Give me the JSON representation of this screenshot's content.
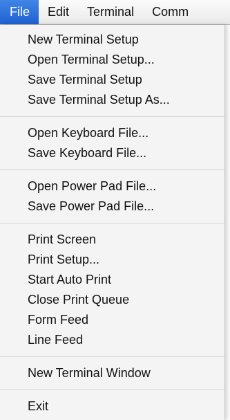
{
  "menubar": {
    "items": [
      {
        "label": "File"
      },
      {
        "label": "Edit"
      },
      {
        "label": "Terminal"
      },
      {
        "label": "Comm"
      }
    ]
  },
  "file_menu": {
    "group1": [
      "New Terminal Setup",
      "Open Terminal Setup...",
      "Save Terminal Setup",
      "Save Terminal Setup As..."
    ],
    "group2": [
      "Open Keyboard File...",
      "Save Keyboard File..."
    ],
    "group3": [
      "Open Power Pad File...",
      "Save Power Pad File..."
    ],
    "group4": [
      "Print Screen",
      "Print Setup...",
      "Start Auto Print",
      "Close Print Queue",
      "Form Feed",
      "Line Feed"
    ],
    "group5": [
      "New Terminal Window"
    ],
    "group6": [
      "Exit"
    ]
  },
  "colors": {
    "selection": "#2a6fdb",
    "menu_background": "#f4f4f4"
  }
}
